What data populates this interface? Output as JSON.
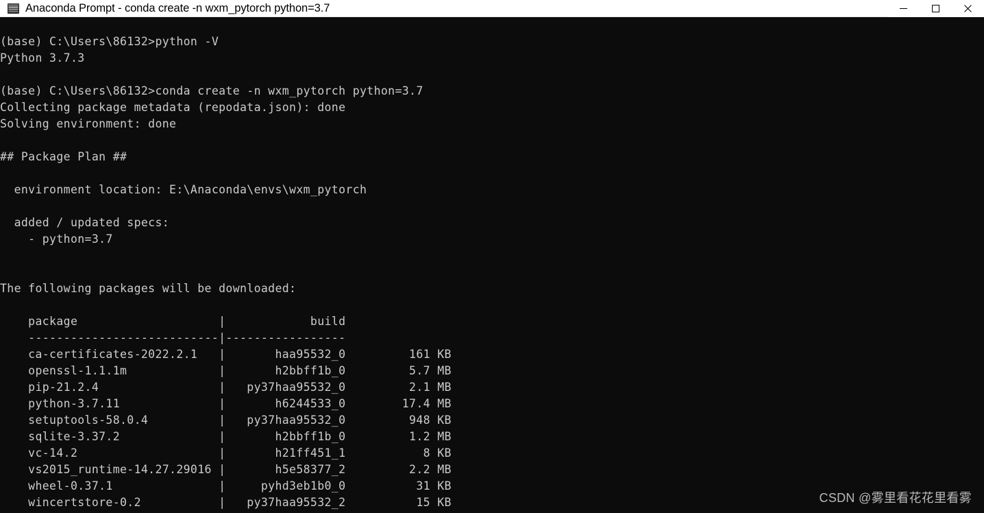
{
  "window": {
    "title": "Anaconda Prompt - conda  create -n wxm_pytorch python=3.7",
    "icon": "console-window-icon",
    "minimize_label": "—",
    "maximize_label": "□",
    "close_label": "✕",
    "titlebar_bg": "#ffffff",
    "titlebar_fg": "#000000"
  },
  "console": {
    "background": "#0c0c0c",
    "foreground": "#cccccc",
    "font_size_px": 16.5,
    "line_height_px": 24,
    "lines": [
      "",
      "(base) C:\\Users\\86132>python -V",
      "Python 3.7.3",
      "",
      "(base) C:\\Users\\86132>conda create -n wxm_pytorch python=3.7",
      "Collecting package metadata (repodata.json): done",
      "Solving environment: done",
      "",
      "## Package Plan ##",
      "",
      "  environment location: E:\\Anaconda\\envs\\wxm_pytorch",
      "",
      "  added / updated specs:",
      "    - python=3.7",
      "",
      "",
      "The following packages will be downloaded:",
      "",
      "    package                    |            build",
      "    ---------------------------|-----------------",
      "    ca-certificates-2022.2.1   |       haa95532_0         161 KB",
      "    openssl-1.1.1m             |       h2bbff1b_0         5.7 MB",
      "    pip-21.2.4                 |   py37haa95532_0         2.1 MB",
      "    python-3.7.11              |       h6244533_0        17.4 MB",
      "    setuptools-58.0.4          |   py37haa95532_0         948 KB",
      "    sqlite-3.37.2              |       h2bbff1b_0         1.2 MB",
      "    vc-14.2                    |       h21ff451_1           8 KB",
      "    vs2015_runtime-14.27.29016 |       h5e58377_2         2.2 MB",
      "    wheel-0.37.1               |     pyhd3eb1b0_0          31 KB",
      "    wincertstore-0.2           |   py37haa95532_2          15 KB"
    ],
    "prompt_user": "(base) C:\\Users\\86132>",
    "commands": [
      "python -V",
      "conda create -n wxm_pytorch python=3.7"
    ],
    "python_version": "Python 3.7.3",
    "status_messages": [
      "Collecting package metadata (repodata.json): done",
      "Solving environment: done"
    ],
    "package_plan_heading": "## Package Plan ##",
    "environment_location_label": "environment location:",
    "environment_location_value": "E:\\Anaconda\\envs\\wxm_pytorch",
    "specs_label": "added / updated specs:",
    "specs": [
      "- python=3.7"
    ],
    "download_notice": "The following packages will be downloaded:",
    "table": {
      "headers": [
        "package",
        "build",
        ""
      ],
      "rows": [
        {
          "package": "ca-certificates-2022.2.1",
          "build": "haa95532_0",
          "size": "161 KB"
        },
        {
          "package": "openssl-1.1.1m",
          "build": "h2bbff1b_0",
          "size": "5.7 MB"
        },
        {
          "package": "pip-21.2.4",
          "build": "py37haa95532_0",
          "size": "2.1 MB"
        },
        {
          "package": "python-3.7.11",
          "build": "h6244533_0",
          "size": "17.4 MB"
        },
        {
          "package": "setuptools-58.0.4",
          "build": "py37haa95532_0",
          "size": "948 KB"
        },
        {
          "package": "sqlite-3.37.2",
          "build": "h2bbff1b_0",
          "size": "1.2 MB"
        },
        {
          "package": "vc-14.2",
          "build": "h21ff451_1",
          "size": "8 KB"
        },
        {
          "package": "vs2015_runtime-14.27.29016",
          "build": "h5e58377_2",
          "size": "2.2 MB"
        },
        {
          "package": "wheel-0.37.1",
          "build": "pyhd3eb1b0_0",
          "size": "31 KB"
        },
        {
          "package": "wincertstore-0.2",
          "build": "py37haa95532_2",
          "size": "15 KB"
        }
      ]
    }
  },
  "watermark": {
    "text": "CSDN @雾里看花花里看雾"
  }
}
